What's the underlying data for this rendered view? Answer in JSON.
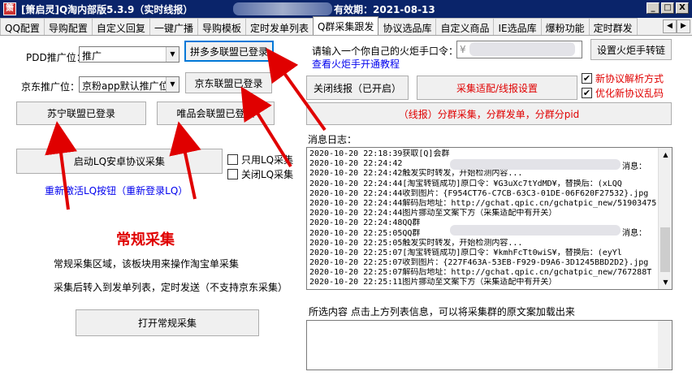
{
  "window": {
    "title": "[箫启灵]Q淘内部版5.3.9（实时线报）",
    "validity": "有效期：2021-08-13",
    "minimize": "_",
    "maximize": "□",
    "close": "X"
  },
  "tabs": [
    "QQ配置",
    "导购配置",
    "自定义回复",
    "一键广播",
    "导购模板",
    "定时发单列表",
    "Q群采集跟发",
    "协议选品库",
    "自定义商品",
    "IE选品库",
    "爆粉功能",
    "定时群发"
  ],
  "active_tab": "Q群采集跟发",
  "left": {
    "pdd_label": "PDD推广位：",
    "pdd_value": "推广",
    "pdd_button": "拼多多联盟已登录",
    "jd_label": "京东推广位：",
    "jd_value": "京粉app默认推广位",
    "jd_button": "京东联盟已登录",
    "suning_button": "苏宁联盟已登录",
    "vip_button": "唯品会联盟已登录",
    "lq_button": "启动LQ安卓协议采集",
    "only_lq": "只用LQ采集",
    "close_lq": "关闭LQ采集",
    "reactivate_link": "重新激活LQ按钮（重新登录LQ）",
    "heading": "常规采集",
    "desc1": "常规采集区域，该板块用来操作淘宝单采集",
    "desc2": "采集后转入到发单列表，定时发送（不支持京东采集）",
    "open_button": "打开常规采集"
  },
  "right": {
    "token_label": "请输入一个你自己的火炬手口令：",
    "token_value": "¥",
    "set_button": "设置火炬手转链",
    "tutorial_link": "查看火炬手开通教程",
    "close_report_button": "关闭线报（已开启）",
    "adapt_button": "采集适配/线报设置",
    "new_protocol": "新协议解析方式",
    "optimize_protocol": "优化新协议乱码",
    "group_button": "（线报）分群采集，分群发单，分群分pid",
    "log_label": "消息日志：",
    "log_lines": [
      "2020-10-20 22:18:39获取[Q]会群",
      "2020-10-20 22:24:42",
      "2020-10-20 22:24:42触发实时转发，开始检测内容...",
      "2020-10-20 22:24:44[淘宝转链成功]原口令：¥G3uXc7tYdMD¥，替换后：(xLQQ",
      "2020-10-20 22:24:44收到图片：{F954CT76-C7CB-63C3-01DE-06F620F27532}.jpg",
      "2020-10-20 22:24:44解码后地址：http://gchat.qpic.cn/gchatpic_new/519034750",
      "2020-10-20 22:24:44图片挪动至文案下方（采集适配中有开关）",
      "2020-10-20 22:24:48QQ群",
      "2020-10-20 22:25:05QQ群",
      "2020-10-20 22:25:05触发实时转发，开始检测内容...",
      "2020-10-20 22:25:07[淘宝转链成功]原口令：¥kmhFcTt0wiS¥，替换后：(eyYl",
      "2020-10-20 22:25:07收到图片：{227F463A-53EB-F929-D9A6-3D1245BBD2D2}.jpg",
      "2020-10-20 22:25:07解码后地址：http://gchat.qpic.cn/gchatpic_new/767288T",
      "2020-10-20 22:25:11图片挪动至文案下方（采集适配中有开关）"
    ],
    "msg_suffix_1": "消息：",
    "msg_suffix_2": "消息：",
    "selected_label": "所选内容 点击上方列表信息，可以将采集群的原文案加载出来"
  },
  "colors": {
    "red": "#e00000",
    "blue_link": "#0000ee",
    "title_bg": "#0a246a"
  }
}
